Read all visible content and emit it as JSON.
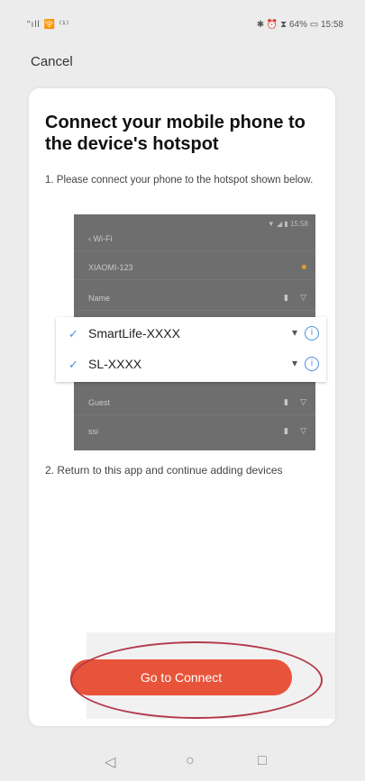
{
  "status_bar": {
    "left": "\"ıll 🛜 ⁽¹⁾",
    "right": "✱ ⏰ ⧗ 64% ▭ 15:58"
  },
  "header": {
    "cancel_label": "Cancel"
  },
  "card": {
    "title": "Connect your mobile phone to the device's hotspot",
    "step1": "1. Please connect your phone to the hotspot shown below.",
    "step2": "2. Return to this app and continue adding devices",
    "phone": {
      "status": "▼ ◢ ▮ 15:58",
      "rows": [
        {
          "name": "‹ Wi-Fi"
        },
        {
          "name": "XIAOMI-123"
        },
        {
          "name": "Name"
        }
      ],
      "rows_bottom": [
        {
          "name": "Guest"
        },
        {
          "name": "ssi"
        }
      ]
    },
    "networks": [
      {
        "name": "SmartLife-XXXX"
      },
      {
        "name": "SL-XXXX"
      }
    ],
    "button_label": "Go to Connect"
  },
  "nav": {
    "back": "◁",
    "home": "○",
    "recent": "□"
  },
  "colors": {
    "accent": "#e8543a",
    "check": "#4a90d9",
    "highlight": "#b3394c"
  }
}
